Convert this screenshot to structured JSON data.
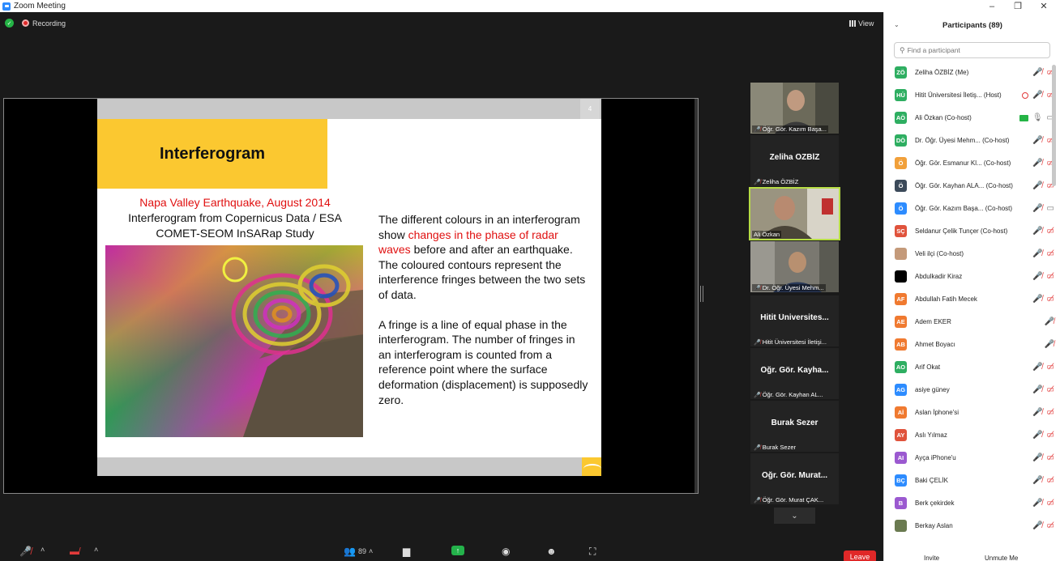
{
  "window": {
    "title": "Zoom Meeting",
    "controls": [
      "–",
      "❐",
      "✕"
    ]
  },
  "status": {
    "recording_label": "Recording",
    "view_label": "View"
  },
  "slide": {
    "page_number": "4",
    "title": "Interferogram",
    "left_line1": "Napa Valley Earthquake, August 2014",
    "left_line2": "Interferogram from Copernicus Data / ESA",
    "left_line3": "COMET-SEOM InSARap Study",
    "para1_before": "The different colours in an interferogram show ",
    "para1_red": "changes in the phase of radar waves",
    "para1_after": " before and after an earthquake. The coloured contours represent the interference fringes between the two sets of data.",
    "para2": "A fringe is a line of equal phase in the interferogram. The number of fringes in an interferogram is counted from a reference point where the surface deformation (displacement) is supposedly zero."
  },
  "video_tiles": [
    {
      "type": "video",
      "name": "Öğr. Gör. Kazım Başa...",
      "muted": true
    },
    {
      "type": "name",
      "display": "Zeliha ÖZBİZ",
      "name": "Zeliha ÖZBİZ",
      "muted": true
    },
    {
      "type": "video",
      "name": "Ali Özkan",
      "muted": false,
      "active": true
    },
    {
      "type": "video",
      "name": "Dr. Öğr. Üyesi Mehm...",
      "muted": true
    },
    {
      "type": "name",
      "display": "Hitit Üniversites...",
      "name": "Hitit Üniversitesi İletişi...",
      "muted": true
    },
    {
      "type": "name",
      "display": "Öğr. Gör. Kayha...",
      "name": "Öğr. Gör. Kayhan AL...",
      "muted": true
    },
    {
      "type": "name",
      "display": "Burak Sezer",
      "name": "Burak Sezer",
      "muted": true
    },
    {
      "type": "name",
      "display": "Öğr. Gör. Murat...",
      "name": "Öğr. Gör. Murat ÇAK...",
      "muted": true
    }
  ],
  "toolbar": {
    "participants_count": "89",
    "leave_label": "Leave"
  },
  "panel": {
    "title": "Participants (89)",
    "search_placeholder": "Find a participant",
    "participants": [
      {
        "initials": "ZÖ",
        "color": "#2eae61",
        "name": "Zeliha ÖZBİZ (Me)",
        "icons": [
          "mute",
          "cam"
        ]
      },
      {
        "initials": "HÜ",
        "color": "#2eae61",
        "name": "Hitit Üniversitesi İletiş... (Host)",
        "icons": [
          "host",
          "mute",
          "cam"
        ]
      },
      {
        "initials": "AÖ",
        "color": "#2eae61",
        "name": "Ali Özkan (Co-host)",
        "icons": [
          "share",
          "mic",
          "camgray"
        ]
      },
      {
        "initials": "DÖ",
        "color": "#2eae61",
        "name": "Dr. Öğr. Üyesi Mehm... (Co-host)",
        "icons": [
          "mute",
          "cam"
        ]
      },
      {
        "initials": "Ö",
        "color": "#f1a03a",
        "name": "Öğr. Gör. Esmanur Kl... (Co-host)",
        "icons": [
          "mute",
          "cam"
        ]
      },
      {
        "initials": "Ö",
        "color": "#3c4a5a",
        "name": "Öğr. Gör. Kayhan ALA... (Co-host)",
        "icons": [
          "mute",
          "cam"
        ]
      },
      {
        "initials": "Ö",
        "color": "#2d8cff",
        "name": "Öğr. Gör. Kazım Başa... (Co-host)",
        "icons": [
          "mute",
          "camgray"
        ]
      },
      {
        "initials": "SÇ",
        "color": "#e0533c",
        "name": "Seldanur Çelik Tunçer (Co-host)",
        "icons": [
          "mute",
          "cam"
        ]
      },
      {
        "initials": "",
        "color": "#c49a7a",
        "name": "Veli ilçi (Co-host)",
        "icons": [
          "mute",
          "cam"
        ]
      },
      {
        "initials": "",
        "color": "#000000",
        "name": "Abdulkadir Kiraz",
        "icons": [
          "mute",
          "cam"
        ]
      },
      {
        "initials": "AF",
        "color": "#f07a30",
        "name": "Abdullah Fatih Mecek",
        "icons": [
          "mute",
          "cam"
        ]
      },
      {
        "initials": "AE",
        "color": "#f07a30",
        "name": "Adem EKER",
        "icons": [
          "mute"
        ]
      },
      {
        "initials": "AB",
        "color": "#f07a30",
        "name": "Ahmet Boyacı",
        "icons": [
          "mute"
        ]
      },
      {
        "initials": "AO",
        "color": "#2eae61",
        "name": "Arif Okat",
        "icons": [
          "mute",
          "cam"
        ]
      },
      {
        "initials": "AG",
        "color": "#2d8cff",
        "name": "asiye güney",
        "icons": [
          "mute",
          "cam"
        ]
      },
      {
        "initials": "Aİ",
        "color": "#f07a30",
        "name": "Aslan İphone'si",
        "icons": [
          "mute",
          "cam"
        ]
      },
      {
        "initials": "AY",
        "color": "#e0533c",
        "name": "Aslı Yılmaz",
        "icons": [
          "mute",
          "cam"
        ]
      },
      {
        "initials": "AI",
        "color": "#9b59d0",
        "name": "Ayça iPhone'u",
        "icons": [
          "mute",
          "cam"
        ]
      },
      {
        "initials": "BÇ",
        "color": "#2d8cff",
        "name": "Baki ÇELİK",
        "icons": [
          "mute",
          "cam"
        ]
      },
      {
        "initials": "B",
        "color": "#9b59d0",
        "name": "Berk çekirdek",
        "icons": [
          "mute",
          "cam"
        ]
      },
      {
        "initials": "",
        "color": "#6a7a50",
        "name": "Berkay Aslan",
        "icons": [
          "mute",
          "cam"
        ]
      }
    ],
    "invite_label": "Invite",
    "unmute_label": "Unmute Me"
  }
}
